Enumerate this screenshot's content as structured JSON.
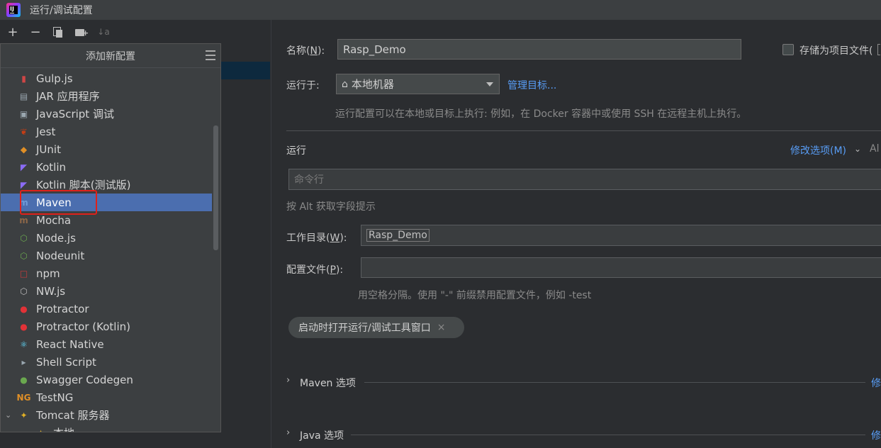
{
  "window": {
    "title": "运行/调试配置"
  },
  "toolbar": {
    "add": "+",
    "remove": "−",
    "sort": "↓a"
  },
  "popup": {
    "title": "添加新配置",
    "items": [
      {
        "label": "Gulp.js",
        "icon": "gulp-icon",
        "glyph": "▮",
        "color": "#cf4646"
      },
      {
        "label": "JAR 应用程序",
        "icon": "jar-icon",
        "glyph": "▤",
        "color": "#9aa7b0"
      },
      {
        "label": "JavaScript 调试",
        "icon": "javascript-debug-icon",
        "glyph": "▣",
        "color": "#9aa7b0"
      },
      {
        "label": "Jest",
        "icon": "jest-icon",
        "glyph": "❦",
        "color": "#c63d14"
      },
      {
        "label": "JUnit",
        "icon": "junit-icon",
        "glyph": "◆",
        "color": "#e08f26"
      },
      {
        "label": "Kotlin",
        "icon": "kotlin-icon",
        "glyph": "◤",
        "color": "#8a6cf5"
      },
      {
        "label": "Kotlin 脚本(测试版)",
        "icon": "kotlin-script-icon",
        "glyph": "◤",
        "color": "#8a6cf5"
      },
      {
        "label": "Maven",
        "icon": "maven-icon",
        "glyph": "m",
        "color": "#6f9bd8"
      },
      {
        "label": "Mocha",
        "icon": "mocha-icon",
        "glyph": "m",
        "color": "#8d6748"
      },
      {
        "label": "Node.js",
        "icon": "nodejs-icon",
        "glyph": "⬡",
        "color": "#6aa84f"
      },
      {
        "label": "Nodeunit",
        "icon": "nodeunit-icon",
        "glyph": "⬡",
        "color": "#6aa84f"
      },
      {
        "label": "npm",
        "icon": "npm-icon",
        "glyph": "□",
        "color": "#c93b3b"
      },
      {
        "label": "NW.js",
        "icon": "nwjs-icon",
        "glyph": "⬡",
        "color": "#bdbdbd"
      },
      {
        "label": "Protractor",
        "icon": "protractor-icon",
        "glyph": "●",
        "color": "#e23237"
      },
      {
        "label": "Protractor (Kotlin)",
        "icon": "protractor-kotlin-icon",
        "glyph": "●",
        "color": "#e23237"
      },
      {
        "label": "React Native",
        "icon": "react-native-icon",
        "glyph": "⚛",
        "color": "#61dafb"
      },
      {
        "label": "Shell Script",
        "icon": "shell-script-icon",
        "glyph": "▸",
        "color": "#9aa7b0"
      },
      {
        "label": "Swagger Codegen",
        "icon": "swagger-icon",
        "glyph": "●",
        "color": "#6aa84f"
      },
      {
        "label": "TestNG",
        "icon": "testng-icon",
        "glyph": "NG",
        "color": "#e08f26"
      },
      {
        "label": "Tomcat 服务器",
        "icon": "tomcat-icon",
        "glyph": "✦",
        "color": "#e0b026"
      },
      {
        "label": "本地",
        "icon": "tomcat-local-icon",
        "glyph": "✦",
        "color": "#e0b026"
      }
    ],
    "selected_index": 7
  },
  "form": {
    "name_label": "名称(",
    "name_mnemonic": "N",
    "name_label_end": "):",
    "name_value": "Rasp_Demo",
    "store_as_file_label": "存储为项目文件(",
    "run_on_label": "运行于:",
    "run_on_value": "本地机器",
    "manage_targets_link": "管理目标...",
    "run_on_hint": "运行配置可以在本地或目标上执行: 例如，在 Docker 容器中或使用 SSH 在远程主机上执行。",
    "run_section": "运行",
    "modify_options_link": "修改选项(M)",
    "modify_options_hint": "Al",
    "command_line_placeholder": "命令行",
    "alt_hint": "按 Alt 获取字段提示",
    "working_dir_label": "工作目录(",
    "working_dir_mnemonic": "W",
    "working_dir_label_end": "):",
    "working_dir_value": "Rasp_Demo",
    "profiles_label": "配置文件(",
    "profiles_mnemonic": "P",
    "profiles_label_end": "):",
    "profiles_hint": "用空格分隔。使用 \"-\" 前缀禁用配置文件，例如 -test",
    "open_tool_window_chip": "启动时打开运行/调试工具窗口",
    "maven_options_section": "Maven 选项",
    "java_options_section": "Java 选项",
    "modify_cut": "修"
  }
}
